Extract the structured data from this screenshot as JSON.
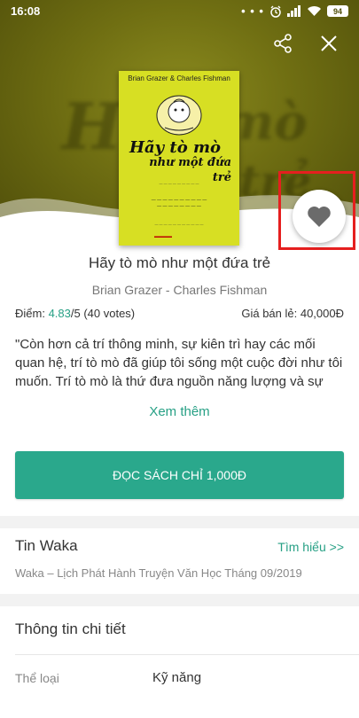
{
  "status_bar": {
    "time": "16:08",
    "battery": "94"
  },
  "header": {
    "share_icon": "share-icon",
    "close_icon": "close-icon",
    "background_color": "#6f6e12"
  },
  "cover": {
    "authors": "Brian Grazer & Charles Fishman",
    "title_line1": "Hãy tò mò",
    "title_line2": "như một đứa trẻ",
    "background_color": "#d7df23"
  },
  "favorite": {
    "icon": "heart-icon",
    "highlight_color": "#e51f1f"
  },
  "book": {
    "title": "Hãy tò mò như một đứa trẻ",
    "authors": "Brian Grazer - Charles Fishman",
    "score_label": "Điểm: ",
    "score_value": "4.83",
    "score_suffix": "/5 (40 votes)",
    "price": "Giá bán lẻ: 40,000Đ",
    "description": "\"Còn hơn cả trí thông minh, sự kiên trì hay các mối quan hệ, trí tò mò đã giúp tôi sống một cuộc đời như tôi muốn. Trí tò mò là thứ đưa nguồn năng lượng và sự",
    "see_more": "Xem thêm"
  },
  "actions": {
    "read_button": "ĐỌC SÁCH CHỈ 1,000Đ",
    "accent_color": "#2aa88c"
  },
  "news": {
    "title": "Tin Waka",
    "link": "Tìm hiểu >>",
    "item": "Waka – Lịch Phát Hành Truyện Văn Học Tháng 09/2019"
  },
  "details": {
    "title": "Thông tin chi tiết",
    "genre_label": "Thể loại",
    "genre_value": "Kỹ năng"
  }
}
